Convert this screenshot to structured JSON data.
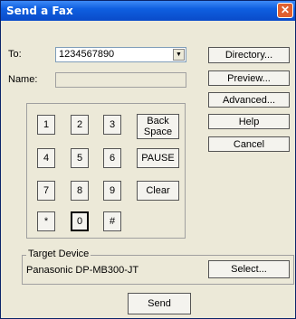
{
  "window": {
    "title": "Send a Fax",
    "close_glyph": "✕"
  },
  "to": {
    "label": "To:",
    "value": "1234567890",
    "arrow": "▼"
  },
  "name": {
    "label": "Name:",
    "value": ""
  },
  "side_buttons": {
    "directory": "Directory...",
    "preview": "Preview...",
    "advanced": "Advanced...",
    "help": "Help",
    "cancel": "Cancel"
  },
  "keypad": {
    "keys": [
      "1",
      "2",
      "3",
      "4",
      "5",
      "6",
      "7",
      "8",
      "9",
      "*",
      "0",
      "#"
    ],
    "backspace_line1": "Back",
    "backspace_line2": "Space",
    "pause": "PAUSE",
    "clear": "Clear"
  },
  "target_device": {
    "label": "Target Device",
    "device": "Panasonic DP-MB300-JT",
    "select": "Select..."
  },
  "send": "Send"
}
